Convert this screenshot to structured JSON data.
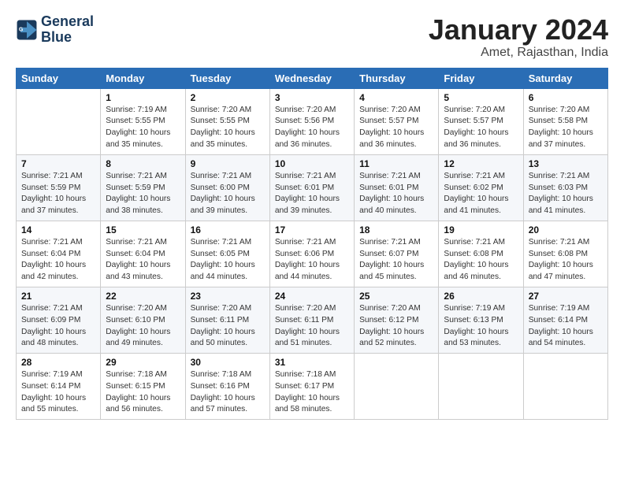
{
  "logo": {
    "line1": "General",
    "line2": "Blue"
  },
  "title": "January 2024",
  "location": "Amet, Rajasthan, India",
  "weekdays": [
    "Sunday",
    "Monday",
    "Tuesday",
    "Wednesday",
    "Thursday",
    "Friday",
    "Saturday"
  ],
  "weeks": [
    [
      {
        "day": "",
        "info": ""
      },
      {
        "day": "1",
        "info": "Sunrise: 7:19 AM\nSunset: 5:55 PM\nDaylight: 10 hours\nand 35 minutes."
      },
      {
        "day": "2",
        "info": "Sunrise: 7:20 AM\nSunset: 5:55 PM\nDaylight: 10 hours\nand 35 minutes."
      },
      {
        "day": "3",
        "info": "Sunrise: 7:20 AM\nSunset: 5:56 PM\nDaylight: 10 hours\nand 36 minutes."
      },
      {
        "day": "4",
        "info": "Sunrise: 7:20 AM\nSunset: 5:57 PM\nDaylight: 10 hours\nand 36 minutes."
      },
      {
        "day": "5",
        "info": "Sunrise: 7:20 AM\nSunset: 5:57 PM\nDaylight: 10 hours\nand 36 minutes."
      },
      {
        "day": "6",
        "info": "Sunrise: 7:20 AM\nSunset: 5:58 PM\nDaylight: 10 hours\nand 37 minutes."
      }
    ],
    [
      {
        "day": "7",
        "info": "Sunrise: 7:21 AM\nSunset: 5:59 PM\nDaylight: 10 hours\nand 37 minutes."
      },
      {
        "day": "8",
        "info": "Sunrise: 7:21 AM\nSunset: 5:59 PM\nDaylight: 10 hours\nand 38 minutes."
      },
      {
        "day": "9",
        "info": "Sunrise: 7:21 AM\nSunset: 6:00 PM\nDaylight: 10 hours\nand 39 minutes."
      },
      {
        "day": "10",
        "info": "Sunrise: 7:21 AM\nSunset: 6:01 PM\nDaylight: 10 hours\nand 39 minutes."
      },
      {
        "day": "11",
        "info": "Sunrise: 7:21 AM\nSunset: 6:01 PM\nDaylight: 10 hours\nand 40 minutes."
      },
      {
        "day": "12",
        "info": "Sunrise: 7:21 AM\nSunset: 6:02 PM\nDaylight: 10 hours\nand 41 minutes."
      },
      {
        "day": "13",
        "info": "Sunrise: 7:21 AM\nSunset: 6:03 PM\nDaylight: 10 hours\nand 41 minutes."
      }
    ],
    [
      {
        "day": "14",
        "info": "Sunrise: 7:21 AM\nSunset: 6:04 PM\nDaylight: 10 hours\nand 42 minutes."
      },
      {
        "day": "15",
        "info": "Sunrise: 7:21 AM\nSunset: 6:04 PM\nDaylight: 10 hours\nand 43 minutes."
      },
      {
        "day": "16",
        "info": "Sunrise: 7:21 AM\nSunset: 6:05 PM\nDaylight: 10 hours\nand 44 minutes."
      },
      {
        "day": "17",
        "info": "Sunrise: 7:21 AM\nSunset: 6:06 PM\nDaylight: 10 hours\nand 44 minutes."
      },
      {
        "day": "18",
        "info": "Sunrise: 7:21 AM\nSunset: 6:07 PM\nDaylight: 10 hours\nand 45 minutes."
      },
      {
        "day": "19",
        "info": "Sunrise: 7:21 AM\nSunset: 6:08 PM\nDaylight: 10 hours\nand 46 minutes."
      },
      {
        "day": "20",
        "info": "Sunrise: 7:21 AM\nSunset: 6:08 PM\nDaylight: 10 hours\nand 47 minutes."
      }
    ],
    [
      {
        "day": "21",
        "info": "Sunrise: 7:21 AM\nSunset: 6:09 PM\nDaylight: 10 hours\nand 48 minutes."
      },
      {
        "day": "22",
        "info": "Sunrise: 7:20 AM\nSunset: 6:10 PM\nDaylight: 10 hours\nand 49 minutes."
      },
      {
        "day": "23",
        "info": "Sunrise: 7:20 AM\nSunset: 6:11 PM\nDaylight: 10 hours\nand 50 minutes."
      },
      {
        "day": "24",
        "info": "Sunrise: 7:20 AM\nSunset: 6:11 PM\nDaylight: 10 hours\nand 51 minutes."
      },
      {
        "day": "25",
        "info": "Sunrise: 7:20 AM\nSunset: 6:12 PM\nDaylight: 10 hours\nand 52 minutes."
      },
      {
        "day": "26",
        "info": "Sunrise: 7:19 AM\nSunset: 6:13 PM\nDaylight: 10 hours\nand 53 minutes."
      },
      {
        "day": "27",
        "info": "Sunrise: 7:19 AM\nSunset: 6:14 PM\nDaylight: 10 hours\nand 54 minutes."
      }
    ],
    [
      {
        "day": "28",
        "info": "Sunrise: 7:19 AM\nSunset: 6:14 PM\nDaylight: 10 hours\nand 55 minutes."
      },
      {
        "day": "29",
        "info": "Sunrise: 7:18 AM\nSunset: 6:15 PM\nDaylight: 10 hours\nand 56 minutes."
      },
      {
        "day": "30",
        "info": "Sunrise: 7:18 AM\nSunset: 6:16 PM\nDaylight: 10 hours\nand 57 minutes."
      },
      {
        "day": "31",
        "info": "Sunrise: 7:18 AM\nSunset: 6:17 PM\nDaylight: 10 hours\nand 58 minutes."
      },
      {
        "day": "",
        "info": ""
      },
      {
        "day": "",
        "info": ""
      },
      {
        "day": "",
        "info": ""
      }
    ]
  ]
}
